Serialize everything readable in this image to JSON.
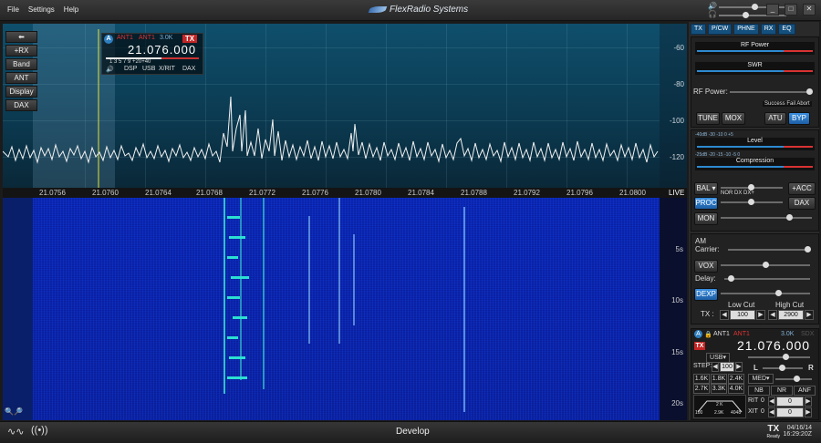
{
  "menu": [
    "File",
    "Settings",
    "Help"
  ],
  "brand": "FlexRadio Systems",
  "window_controls": [
    "_",
    "□",
    "✕"
  ],
  "pan_buttons": [
    "+RX",
    "Band",
    "ANT",
    "Display",
    "DAX"
  ],
  "db_scale": [
    "-60",
    "-80",
    "-100",
    "-120"
  ],
  "freq_ticks": [
    "21.0756",
    "21.0760",
    "21.0764",
    "21.0768",
    "21.0772",
    "21.0776",
    "21.0780",
    "21.0784",
    "21.0788",
    "21.0792",
    "21.0796",
    "21.0800"
  ],
  "live_label": "LIVE",
  "time_ticks": [
    "5s",
    "10s",
    "15s",
    "20s"
  ],
  "slice": {
    "letter": "A",
    "ant_tx": "ANT1",
    "ant_rx": "ANT1",
    "bw": "3.0K",
    "tx_label": "TX",
    "frequency": "21.076.000",
    "smeter_scale": "1  3  5  7  9  +20+40",
    "tabs": [
      "DSP",
      "USB",
      "X/RIT",
      "DAX"
    ]
  },
  "side_tabs": [
    "TX",
    "P/CW",
    "PHNE",
    "RX",
    "EQ"
  ],
  "tx_panel": {
    "rf_power_meter": "RF Power",
    "swr_meter": "SWR",
    "rf_power_label": "RF Power:",
    "atu_status": "Success  Fail  Abort",
    "buttons": [
      "TUNE",
      "MOX",
      "ATU",
      "BYP"
    ]
  },
  "ph_panel": {
    "level_meter": "Level",
    "compression_meter": "Compression",
    "level_scale": "-40dB  -30  -10  0  +5",
    "comp_scale": "-25dB  -20  -15  -10  -5  0",
    "bal_label": "BAL",
    "acc_button": "+ACC",
    "nor_dx": "NOR   DX   DX+",
    "proc_button": "PROC",
    "dax_button": "DAX",
    "mon_button": "MON"
  },
  "am_panel": {
    "carrier_label": "AM\nCarrier:",
    "vox_button": "VOX",
    "delay_label": "Delay:",
    "dexp_button": "DEXP",
    "tx_label": "TX :",
    "low_cut_label": "Low Cut",
    "high_cut_label": "High Cut",
    "low_cut_value": "100",
    "high_cut_value": "2900"
  },
  "vfo": {
    "letter": "A",
    "ant_tx": "ANT1",
    "ant_rx": "ANT1",
    "bw": "3.0K",
    "sdx": "SDX",
    "tx_badge": "TX",
    "frequency": "21.076.000",
    "mode": "USB",
    "step_label": "STEP:",
    "step_value": "100",
    "agc": "MED",
    "lr": [
      "L",
      "R"
    ],
    "filters": [
      "1.6K",
      "1.8K",
      "2.4K",
      "2.7K",
      "3.3K",
      "4.0K"
    ],
    "filter_display": [
      "100",
      "2.9K",
      "4048",
      "2 K"
    ],
    "nb": "NB",
    "nr": "NR",
    "anf": "ANF",
    "rit_label": "RIT",
    "xit_label": "XIT",
    "rit_val": "0",
    "xit_val": "0",
    "rit_offset": "0",
    "xit_offset": "0"
  },
  "status": {
    "center_text": "Develop",
    "tx": "TX",
    "tx_sub": "Ready",
    "date": "04/16/14",
    "time": "16:29:20Z"
  }
}
